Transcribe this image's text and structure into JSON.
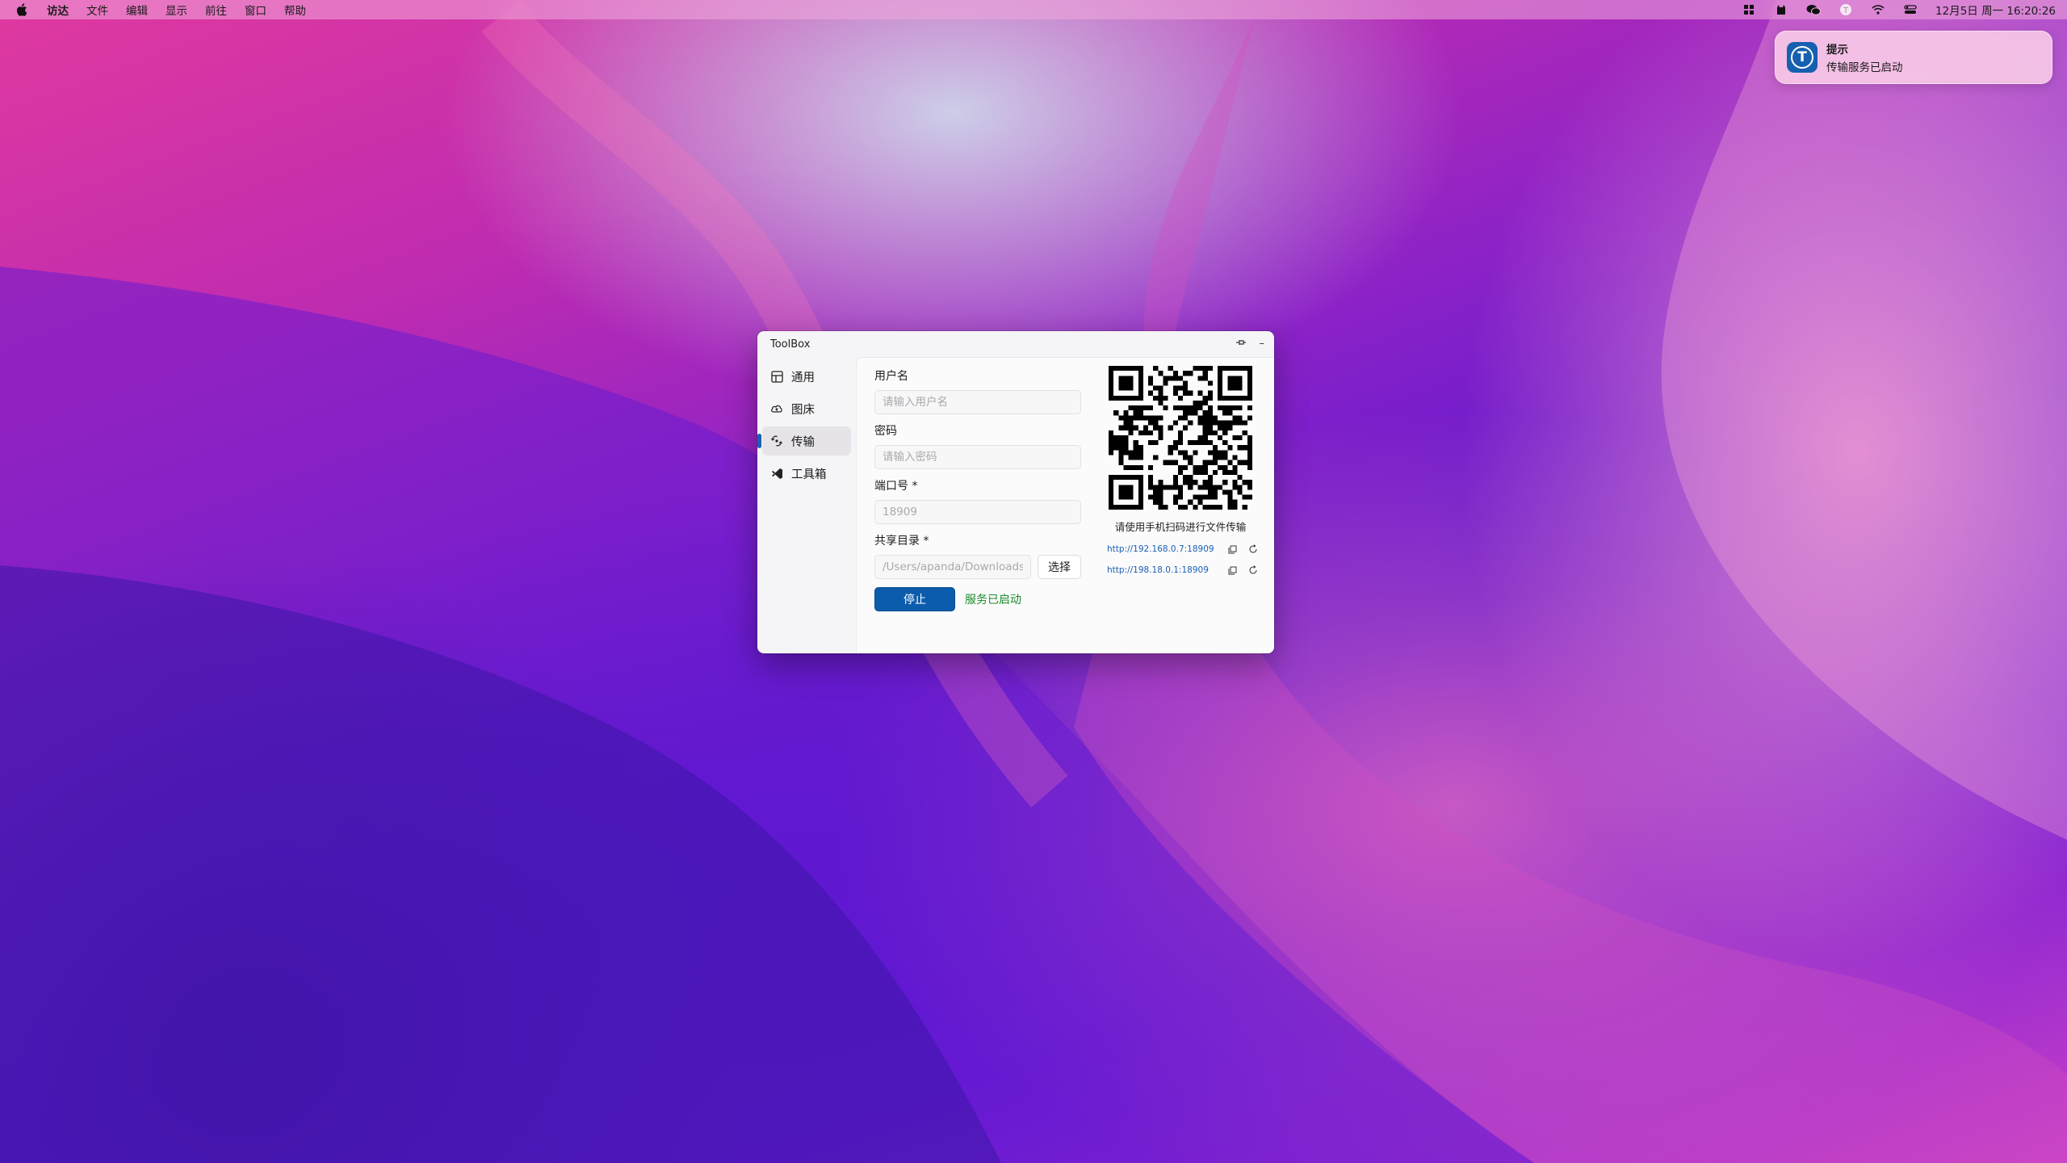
{
  "menubar": {
    "apple_icon": "apple-icon",
    "items": [
      "访达",
      "文件",
      "编辑",
      "显示",
      "前往",
      "窗口",
      "帮助"
    ],
    "status_icons": [
      "app-grid-icon",
      "cat-icon",
      "wechat-icon",
      "toolbox-icon",
      "wifi-icon",
      "control-center-icon"
    ],
    "clock": "12月5日 周一 16:20:26"
  },
  "notification": {
    "icon_letter": "T",
    "title": "提示",
    "body": "传输服务已启动"
  },
  "window": {
    "title": "ToolBox",
    "pin_icon": "pin-icon",
    "minimize_label": "–"
  },
  "sidebar": {
    "items": [
      {
        "label": "通用",
        "icon": "layout-icon"
      },
      {
        "label": "图床",
        "icon": "cloud-upload-icon"
      },
      {
        "label": "传输",
        "icon": "transfer-icon"
      },
      {
        "label": "工具箱",
        "icon": "toolbox-icon"
      }
    ],
    "active_index": 2
  },
  "form": {
    "username_label": "用户名",
    "username_placeholder": "请输入用户名",
    "password_label": "密码",
    "password_placeholder": "请输入密码",
    "port_label": "端口号 *",
    "port_placeholder": "18909",
    "share_dir_label": "共享目录 *",
    "share_dir_placeholder": "/Users/apanda/Downloads",
    "select_button": "选择",
    "stop_button": "停止",
    "status": "服务已启动"
  },
  "qr": {
    "hint": "请使用手机扫码进行文件传输",
    "urls": [
      "http://192.168.0.7:18909",
      "http://198.18.0.1:18909"
    ]
  },
  "colors": {
    "accent": "#1a5fb4",
    "stop_button": "#0b5cad",
    "status_ok": "#1b8a2a"
  }
}
